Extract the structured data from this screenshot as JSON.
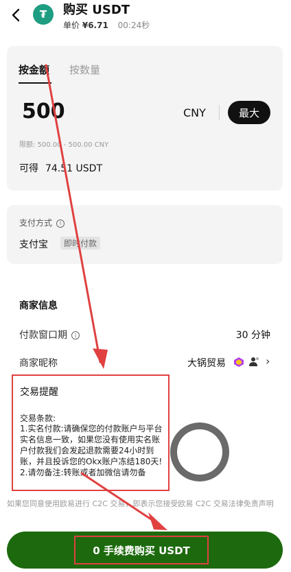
{
  "header": {
    "title": "购买 USDT",
    "price_label": "单价",
    "price": "¥6.71",
    "timer": "00:24秒",
    "coin_icon": "tether-icon"
  },
  "order": {
    "tab_amount": "按金额",
    "tab_quantity": "按数量",
    "amount": "500",
    "currency": "CNY",
    "max_label": "最大",
    "limit": "限额: 500.00 - 500.00 CNY",
    "receive_label": "可得",
    "receive_value": "74.51 USDT"
  },
  "payment": {
    "label": "支付方式",
    "method": "支付宝",
    "badge": "即时付款"
  },
  "merchant": {
    "title": "商家信息",
    "window_label": "付款窗口期",
    "window_value": "30 分钟",
    "nick_label": "商家昵称",
    "nick_value": "大锅贸易"
  },
  "reminder": {
    "title": "交易提醒",
    "terms_title": "交易条款:",
    "terms_body": "1.实名付款:请确保您的付款账户与平台实名信息一致，如果您没有使用实名账户付款我们会发起退款需要24小时到账，并且投诉您的Okx账户冻结180天!\n2.请勿备注:转账或者加微信请勿备"
  },
  "disclaimer": "如果您同意使用欧易进行 C2C 交易，即表示您接受欧易 C2C 交易法律免责声明",
  "buy_button": "0 手续费购买 USDT",
  "colors": {
    "accent_green": "#1d6a0e",
    "annotation_red": "#e04040",
    "tether_green": "#1f9d82"
  }
}
